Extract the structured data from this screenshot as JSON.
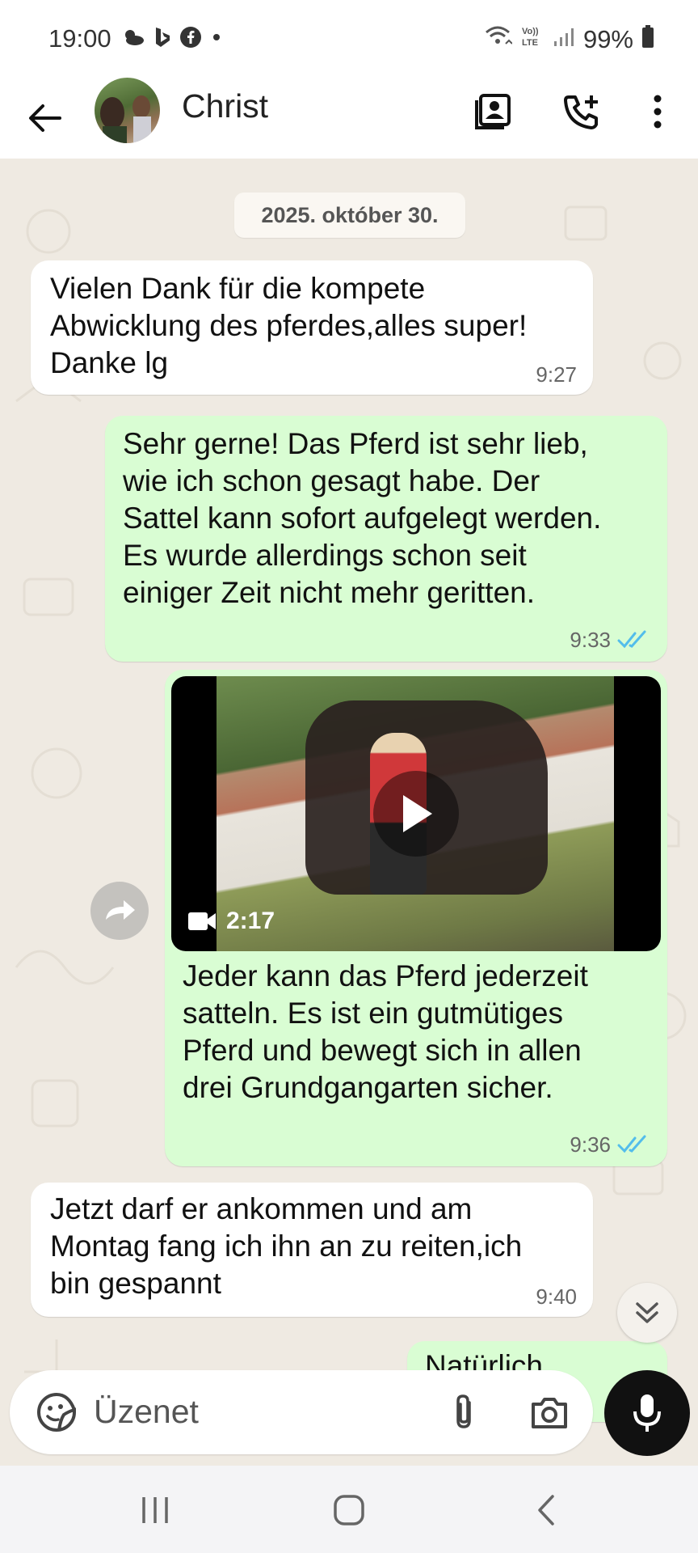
{
  "status_bar": {
    "time": "19:00",
    "battery": "99%",
    "icons_left": [
      "cloud-sun-icon",
      "bing-icon",
      "facebook-icon",
      "dot-icon"
    ],
    "icons_right": [
      "wifi-calling-icon",
      "volte-icon",
      "signal-icon",
      "battery-icon"
    ]
  },
  "header": {
    "contact_name": "Christ",
    "icons": [
      "back-arrow-icon",
      "contact-card-icon",
      "add-call-icon",
      "more-vert-icon"
    ]
  },
  "chat": {
    "date_chip": "2025. október 30.",
    "messages": [
      {
        "direction": "in",
        "text": "Vielen Dank für die  kompete\nAbwicklung des pferdes,alles super!\nDanke lg",
        "time": "9:27"
      },
      {
        "direction": "out",
        "text": "Sehr gerne! Das Pferd ist sehr lieb,\nwie ich schon gesagt habe. Der\nSattel kann sofort aufgelegt werden.\nEs wurde allerdings schon seit\neiniger Zeit nicht mehr geritten.",
        "time": "9:33",
        "status": "read"
      },
      {
        "direction": "out",
        "type": "video",
        "video_duration": "2:17",
        "text": "Jeder kann das Pferd jederzeit\nsatteln. Es ist ein gutmütiges\nPferd und bewegt sich in allen\ndrei Grundgangarten sicher.",
        "time": "9:36",
        "status": "read"
      },
      {
        "direction": "in",
        "text": "Jetzt darf er ankommen und am\nMontag fang ich ihn an zu reiten,ich\nbin gespannt",
        "time": "9:40"
      },
      {
        "direction": "out",
        "text": "Natürlich",
        "partial": true
      }
    ]
  },
  "composer": {
    "placeholder": "Üzenet"
  },
  "colors": {
    "chat_bg": "#efeae2",
    "incoming_bubble": "#ffffff",
    "outgoing_bubble": "#d9fdd3",
    "read_tick": "#53bdeb"
  }
}
